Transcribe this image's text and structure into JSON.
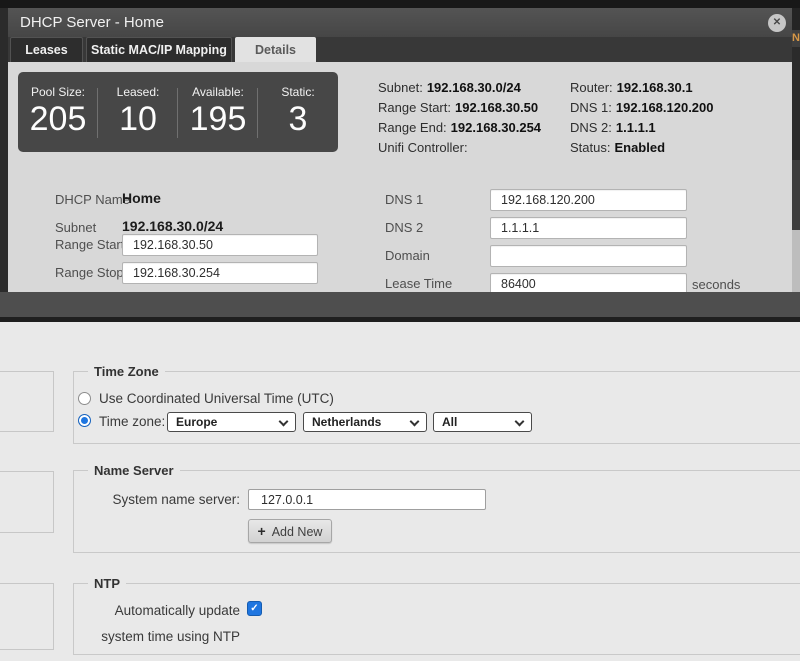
{
  "edge": {
    "text": "N"
  },
  "icons": {
    "close": "✕",
    "check": "✓",
    "plus": "+"
  },
  "colors": {
    "accent_blue": "#1f76e0",
    "edge_orange": "#d79746",
    "dark_panel": "#474747",
    "modal_header": "#4a4a4a"
  },
  "modal": {
    "title": "DHCP Server - Home",
    "tabs": [
      {
        "label": "Leases",
        "active": false
      },
      {
        "label": "Static MAC/IP Mapping",
        "active": false
      },
      {
        "label": "Details",
        "active": true
      }
    ],
    "stats": [
      {
        "label": "Pool Size:",
        "value": "205"
      },
      {
        "label": "Leased:",
        "value": "10"
      },
      {
        "label": "Available:",
        "value": "195"
      },
      {
        "label": "Static:",
        "value": "3"
      }
    ],
    "info_left": [
      {
        "label": "Subnet:",
        "value": "192.168.30.0/24"
      },
      {
        "label": "Range Start:",
        "value": "192.168.30.50"
      },
      {
        "label": "Range End:",
        "value": "192.168.30.254"
      },
      {
        "label": "Unifi Controller:",
        "value": ""
      }
    ],
    "info_right": [
      {
        "label": "Router:",
        "value": "192.168.30.1"
      },
      {
        "label": "DNS 1:",
        "value": "192.168.120.200"
      },
      {
        "label": "DNS 2:",
        "value": "1.1.1.1"
      },
      {
        "label": "Status:",
        "value": "Enabled"
      }
    ],
    "form_left": [
      {
        "label": "DHCP Name",
        "value": "Home"
      },
      {
        "label": "Subnet",
        "value": "192.168.30.0/24"
      },
      {
        "label": "Range Start",
        "value": "192.168.30.50"
      },
      {
        "label": "Range Stop",
        "value": "192.168.30.254"
      }
    ],
    "form_right": [
      {
        "label": "DNS 1",
        "value": "192.168.120.200"
      },
      {
        "label": "DNS 2",
        "value": "1.1.1.1"
      },
      {
        "label": "Domain",
        "value": ""
      },
      {
        "label": "Lease Time",
        "value": "86400",
        "suffix": "seconds"
      }
    ]
  },
  "settings_page": {
    "time_zone": {
      "legend": "Time Zone",
      "utc_option": "Use Coordinated Universal Time (UTC)",
      "tz_option": "Time zone:",
      "selects": [
        {
          "name": "region",
          "value": "Europe"
        },
        {
          "name": "country",
          "value": "Netherlands"
        },
        {
          "name": "city",
          "value": "All"
        }
      ]
    },
    "name_server": {
      "legend": "Name Server",
      "label": "System name server:",
      "value": "127.0.0.1",
      "button": "Add New"
    },
    "ntp": {
      "legend": "NTP",
      "label_line1": "Automatically update",
      "label_line2": "system time using NTP",
      "checked": true
    }
  }
}
